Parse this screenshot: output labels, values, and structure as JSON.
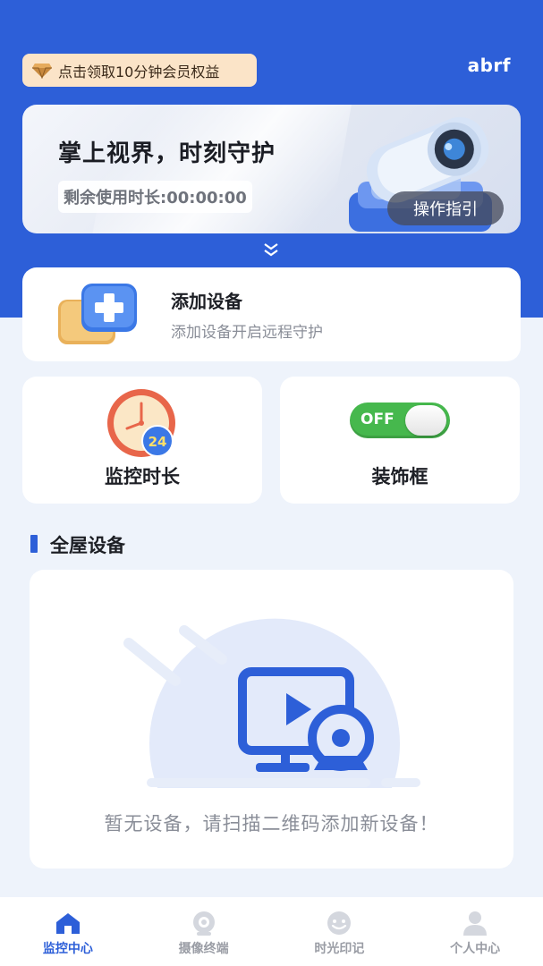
{
  "header": {
    "vip_promo": "点击领取10分钟会员权益",
    "username": "abrf"
  },
  "banner": {
    "title": "掌上视界，时刻守护",
    "remaining_time": "剩余使用时长:00:00:00",
    "guide_button": "操作指引"
  },
  "add_device": {
    "title": "添加设备",
    "subtitle": "添加设备开启远程守护"
  },
  "features": [
    {
      "label": "监控时长",
      "icon": "clock-24-icon"
    },
    {
      "label": "装饰框",
      "icon": "toggle-off-icon",
      "toggle_text": "OFF"
    }
  ],
  "section": {
    "title": "全屋设备",
    "empty_text": "暂无设备，请扫描二维码添加新设备！"
  },
  "tabs": [
    {
      "label": "监控中心",
      "icon": "home-icon",
      "active": true
    },
    {
      "label": "摄像终端",
      "icon": "camera-icon",
      "active": false
    },
    {
      "label": "时光印记",
      "icon": "smile-icon",
      "active": false
    },
    {
      "label": "个人中心",
      "icon": "person-icon",
      "active": false
    }
  ],
  "colors": {
    "primary": "#2d5fd8",
    "background": "#eef3fb",
    "promo": "#fbe4c8",
    "toggle_green": "#46b84d"
  }
}
